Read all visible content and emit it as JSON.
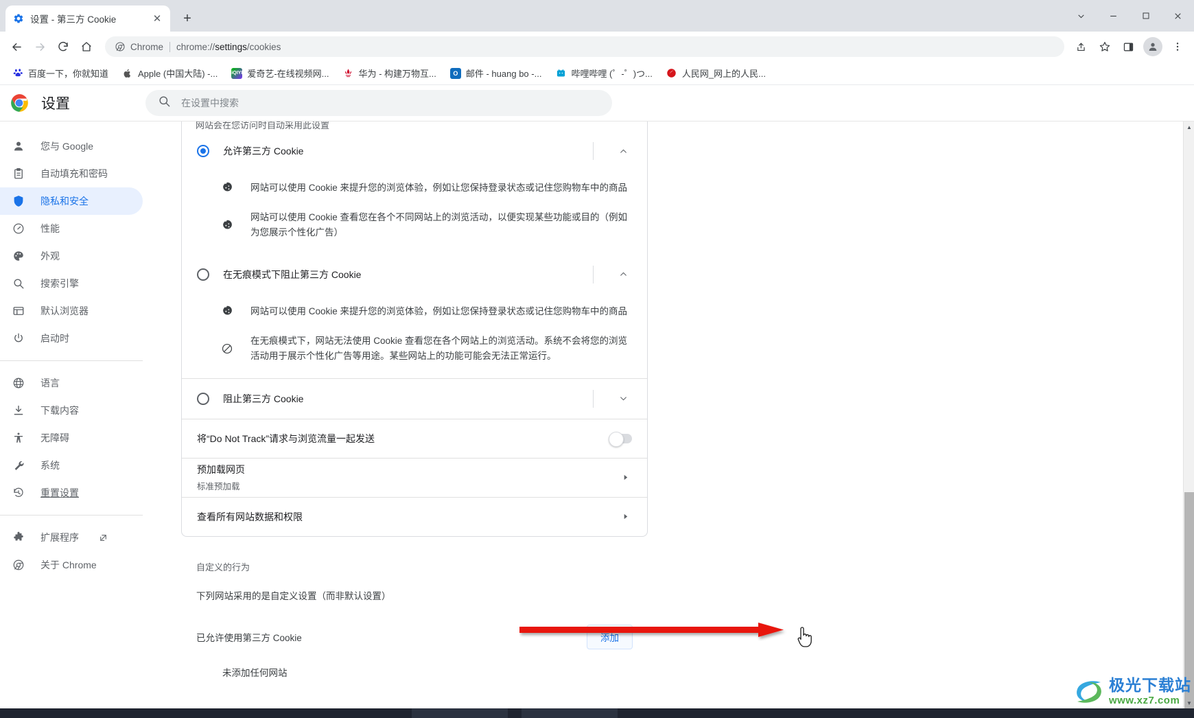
{
  "window": {
    "controls": {
      "more_tabs": "chevron-down",
      "minimize": "—",
      "maximize": "□",
      "close": "✕"
    }
  },
  "tab": {
    "title": "设置 - 第三方 Cookie",
    "close_label": "✕",
    "new_tab_label": "+"
  },
  "toolbar": {
    "back": "←",
    "forward": "→",
    "reload": "⟳",
    "home": "⌂",
    "omnibox": {
      "chip_label": "Chrome",
      "url_prefix": "chrome://",
      "url_bold": "settings",
      "url_suffix": "/cookies"
    },
    "share": "share-icon",
    "bookmark_star": "☆",
    "side_panel": "side-panel-icon",
    "profile": "profile-icon",
    "menu": "⋮"
  },
  "bookmarks": [
    {
      "label": "百度一下，你就知道",
      "icon": "baidu",
      "color": "#2932e1"
    },
    {
      "label": "Apple (中国大陆) -...",
      "icon": "apple",
      "color": "#555555"
    },
    {
      "label": "爱奇艺-在线视频网...",
      "icon": "iqiyi",
      "color": "#00be06"
    },
    {
      "label": "华为 - 构建万物互...",
      "icon": "huawei",
      "color": "#cf0a2c"
    },
    {
      "label": "邮件 - huang bo -...",
      "icon": "outlook",
      "color": "#0f6cbd"
    },
    {
      "label": "哔哩哔哩 (゜-゜)つ...",
      "icon": "bilibili",
      "color": "#00a1d6"
    },
    {
      "label": "人民网_网上的人民...",
      "icon": "people",
      "color": "#d5151b"
    }
  ],
  "settings": {
    "title": "设置",
    "search_placeholder": "在设置中搜索",
    "search_value": "",
    "sidebar": [
      {
        "label": "您与 Google",
        "icon": "person-icon",
        "active": false
      },
      {
        "label": "自动填充和密码",
        "icon": "clipboard-icon",
        "active": false
      },
      {
        "label": "隐私和安全",
        "icon": "shield-icon",
        "active": true
      },
      {
        "label": "性能",
        "icon": "speedometer-icon",
        "active": false
      },
      {
        "label": "外观",
        "icon": "palette-icon",
        "active": false
      },
      {
        "label": "搜索引擎",
        "icon": "search-icon",
        "active": false
      },
      {
        "label": "默认浏览器",
        "icon": "browser-icon",
        "active": false
      },
      {
        "label": "启动时",
        "icon": "power-icon",
        "active": false
      },
      {
        "label": "语言",
        "icon": "globe-icon",
        "active": false,
        "group": 2
      },
      {
        "label": "下载内容",
        "icon": "download-icon",
        "active": false,
        "group": 2
      },
      {
        "label": "无障碍",
        "icon": "accessibility-icon",
        "active": false,
        "group": 2
      },
      {
        "label": "系统",
        "icon": "wrench-icon",
        "active": false,
        "group": 2
      },
      {
        "label": "重置设置",
        "icon": "history-icon",
        "active": false,
        "group": 2
      },
      {
        "label": "扩展程序",
        "icon": "extension-icon",
        "active": false,
        "group": 3,
        "external": true
      },
      {
        "label": "关于 Chrome",
        "icon": "chrome-icon",
        "active": false,
        "group": 3
      }
    ],
    "clipped_note": "网站会在您访问时自动采用此设置",
    "cookie_options": [
      {
        "label": "允许第三方 Cookie",
        "selected": true,
        "expanded": true,
        "bullets": [
          {
            "icon": "cookie-icon",
            "text": "网站可以使用 Cookie 来提升您的浏览体验，例如让您保持登录状态或记住您购物车中的商品"
          },
          {
            "icon": "cookie-icon",
            "text": "网站可以使用 Cookie 查看您在各个不同网站上的浏览活动，以便实现某些功能或目的（例如为您展示个性化广告）"
          }
        ]
      },
      {
        "label": "在无痕模式下阻止第三方 Cookie",
        "selected": false,
        "expanded": true,
        "bullets": [
          {
            "icon": "cookie-icon",
            "text": "网站可以使用 Cookie 来提升您的浏览体验，例如让您保持登录状态或记住您购物车中的商品"
          },
          {
            "icon": "block-icon",
            "text": "在无痕模式下，网站无法使用 Cookie 查看您在各个网站上的浏览活动。系统不会将您的浏览活动用于展示个性化广告等用途。某些网站上的功能可能会无法正常运行。"
          }
        ]
      },
      {
        "label": "阻止第三方 Cookie",
        "selected": false,
        "expanded": false,
        "bullets": []
      }
    ],
    "do_not_track": {
      "label": "将“Do Not Track”请求与浏览流量一起发送",
      "enabled": false
    },
    "preload": {
      "title": "预加载网页",
      "subtitle": "标准预加载"
    },
    "all_site_data": {
      "title": "查看所有网站数据和权限"
    },
    "custom": {
      "heading": "自定义的行为",
      "description": "下列网站采用的是自定义设置（而非默认设置）",
      "list_label": "已允许使用第三方 Cookie",
      "add_button": "添加",
      "empty_text": "未添加任何网站"
    }
  },
  "watermark": {
    "line1": "极光下载站",
    "line2": "www.xz7.com"
  }
}
